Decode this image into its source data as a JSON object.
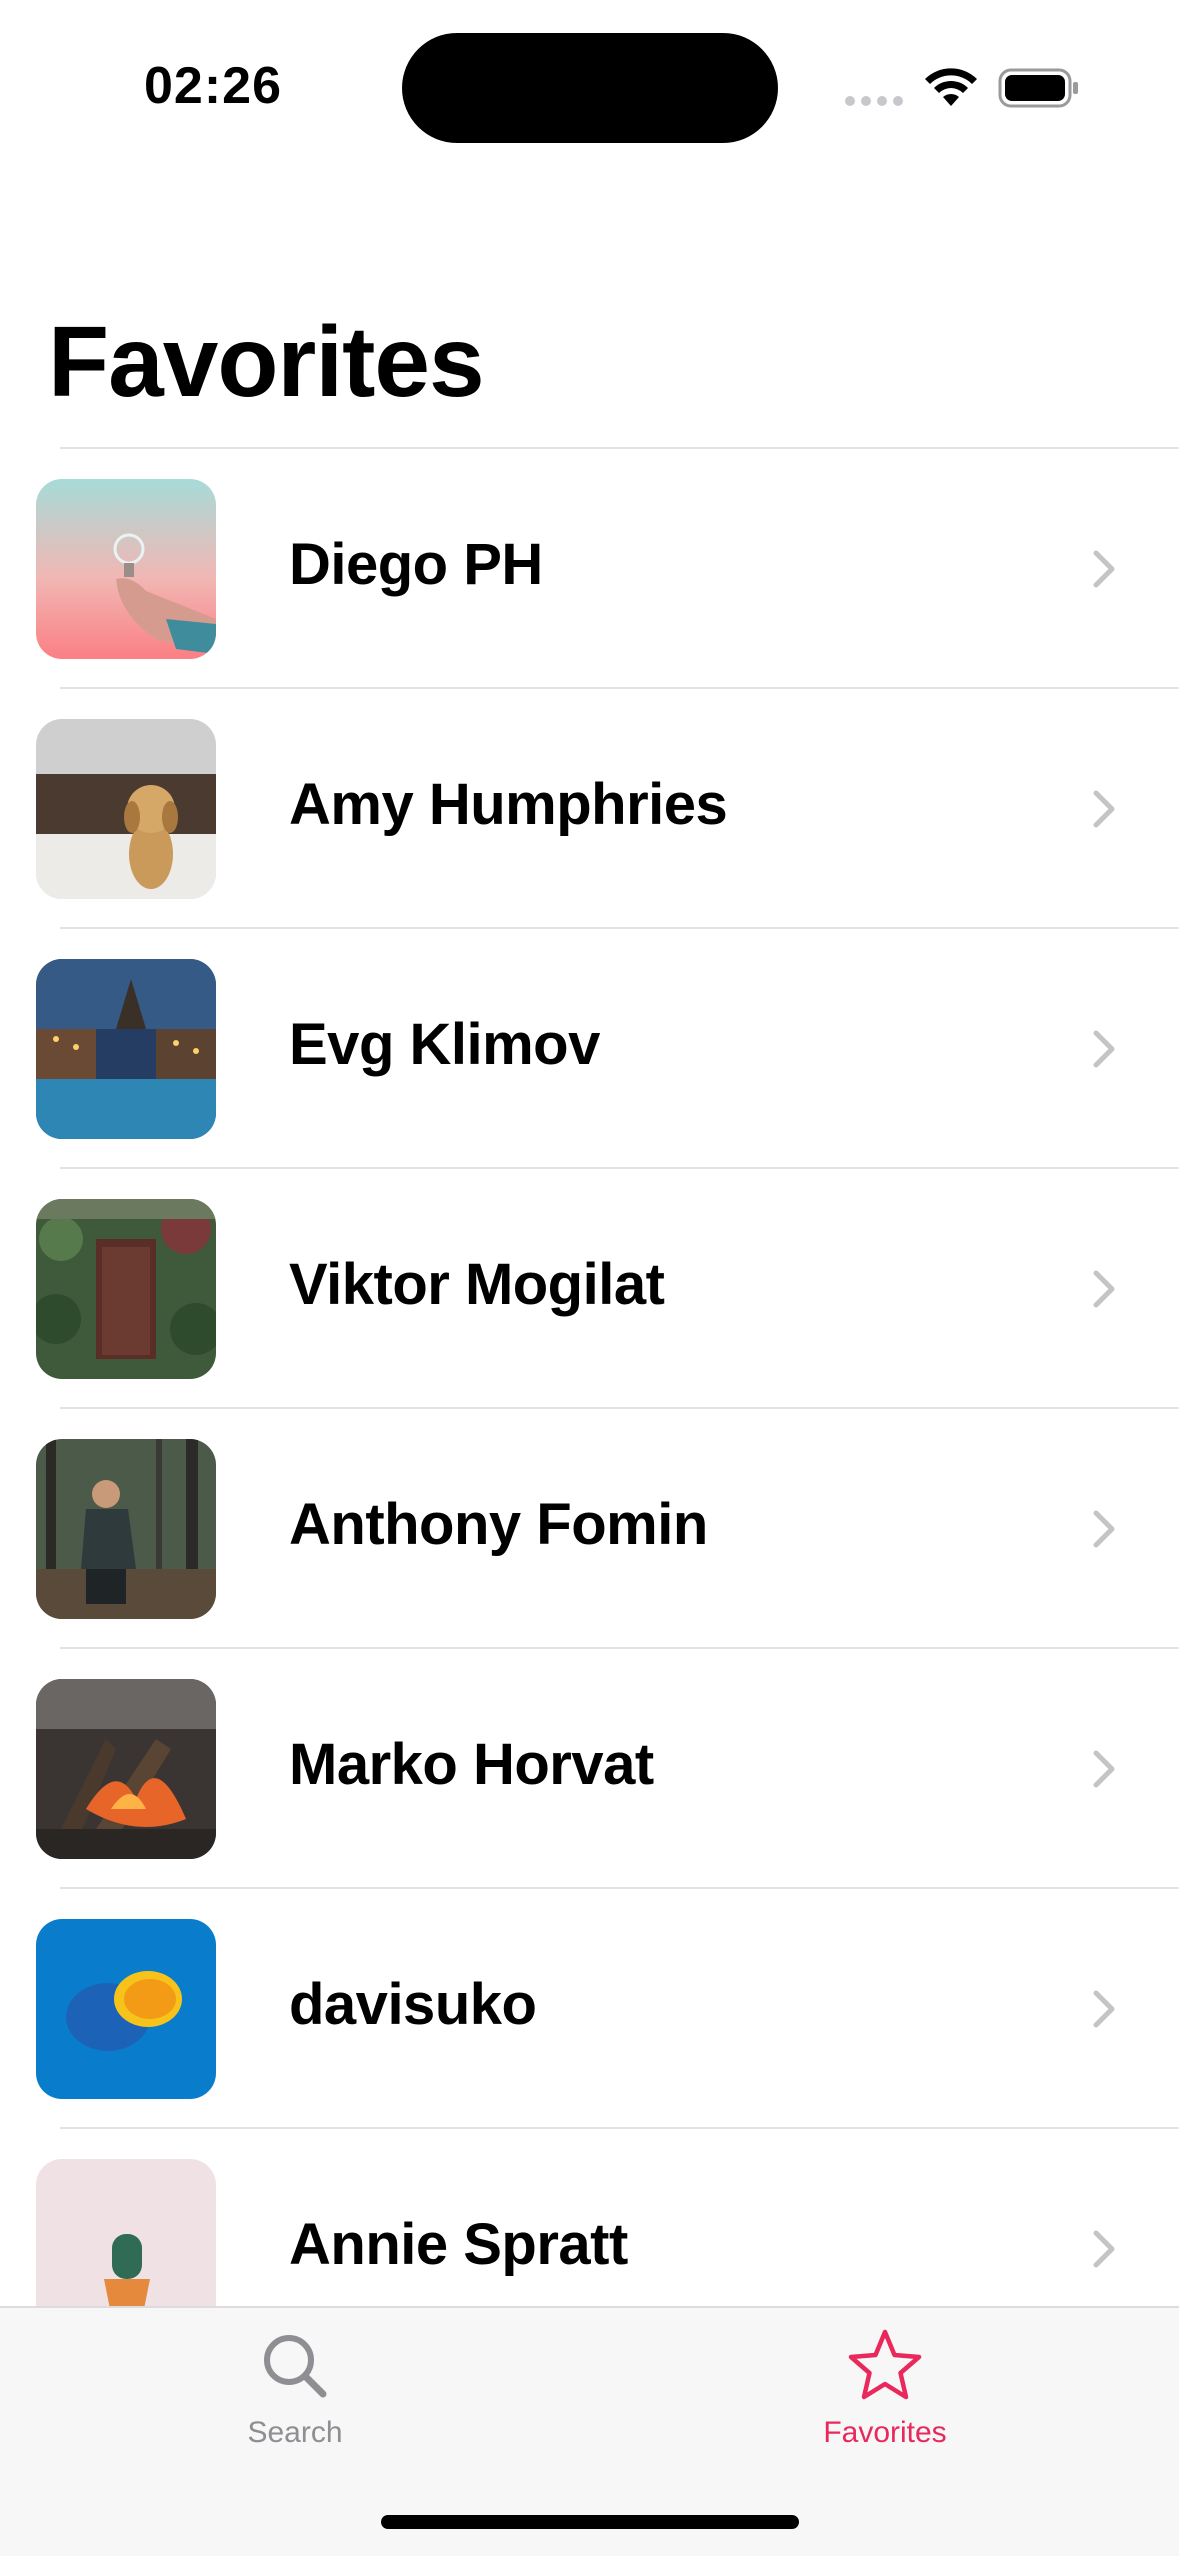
{
  "status_bar": {
    "time": "02:26"
  },
  "header": {
    "title": "Favorites"
  },
  "favorites": [
    {
      "name": "Diego PH",
      "thumb": "lightbulb-photo"
    },
    {
      "name": "Amy Humphries",
      "thumb": "puppy-photo"
    },
    {
      "name": "Evg Klimov",
      "thumb": "city-canal-photo"
    },
    {
      "name": "Viktor Mogilat",
      "thumb": "ivy-door-photo"
    },
    {
      "name": "Anthony Fomin",
      "thumb": "man-in-forest-photo"
    },
    {
      "name": "Marko Horvat",
      "thumb": "campfire-photo"
    },
    {
      "name": "davisuko",
      "thumb": "lemon-photo"
    },
    {
      "name": "Annie Spratt",
      "thumb": "cactus-photo"
    }
  ],
  "tabbar": {
    "search_label": "Search",
    "favorites_label": "Favorites",
    "active_tab": "Favorites",
    "accent_color": "#e9285c",
    "inactive_color": "#8e8e93"
  }
}
